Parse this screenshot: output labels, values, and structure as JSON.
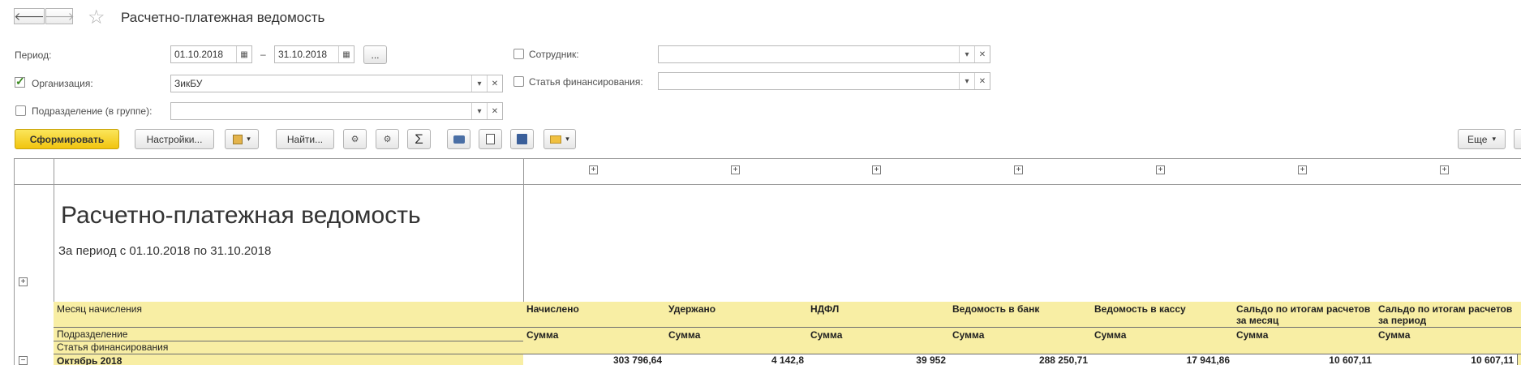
{
  "window": {
    "title": "Расчетно-платежная ведомость"
  },
  "nav": {
    "back_glyph": "🡐",
    "forward_glyph": "🡒",
    "star_glyph": "☆"
  },
  "filters": {
    "period_label": "Период:",
    "period_from": "01.10.2018",
    "period_dash": "–",
    "period_to": "31.10.2018",
    "period_more": "...",
    "org_label": "Организация:",
    "org_value": "ЗикБУ",
    "org_checked": true,
    "dept_label": "Подразделение (в группе):",
    "dept_value": "",
    "employee_label": "Сотрудник:",
    "employee_value": "",
    "funding_label": "Статья финансирования:",
    "funding_value": ""
  },
  "toolbar": {
    "generate": "Сформировать",
    "settings": "Настройки...",
    "find": "Найти...",
    "more": "Еще"
  },
  "report": {
    "title": "Расчетно-платежная ведомость",
    "subtitle": "За период с 01.10.2018 по 31.10.2018",
    "col_first_top": "Месяц начисления",
    "col_first_mid": "Подразделение",
    "col_first_bot": "Статья финансирования",
    "sum_label": "Сумма",
    "columns": [
      {
        "name": "Начислено"
      },
      {
        "name": "Удержано"
      },
      {
        "name": "НДФЛ"
      },
      {
        "name": "Ведомость в банк"
      },
      {
        "name": "Ведомость в кассу"
      },
      {
        "name": "Сальдо по итогам расчетов за месяц"
      },
      {
        "name": "Сальдо по итогам расчетов за период"
      }
    ],
    "row": {
      "label": "Октябрь 2018",
      "values": [
        "303 796,64",
        "4 142,8",
        "39 952",
        "288 250,71",
        "17 941,86",
        "10 607,11",
        "10 607,11"
      ]
    }
  },
  "colors": {
    "accent_yellow": "#f1c40f",
    "header_fill": "#f8eea4"
  }
}
